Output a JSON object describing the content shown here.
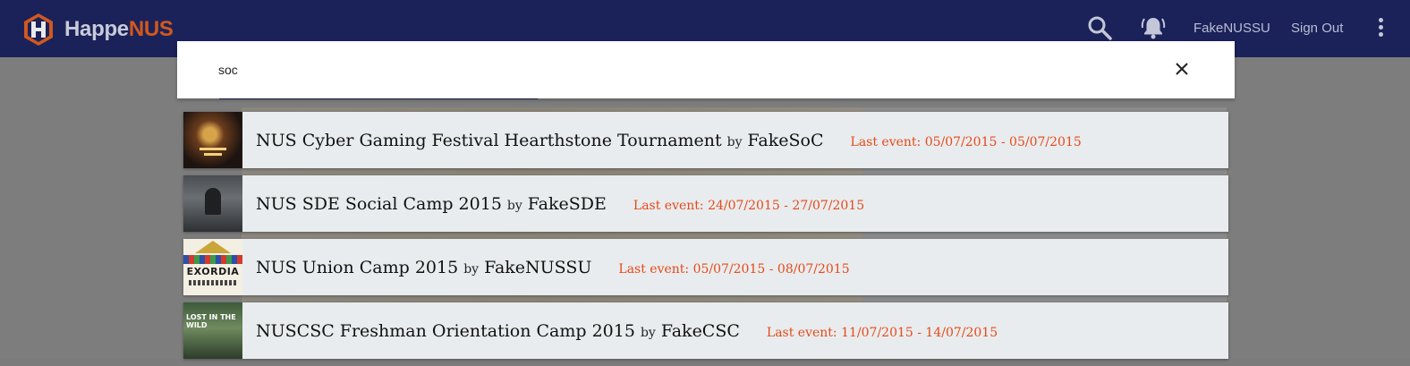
{
  "app": {
    "brand_part1": "Happe",
    "brand_part2": "NUS",
    "brand_color": "#d1581e",
    "topbar_color": "#1b2259"
  },
  "topbar": {
    "search_icon": "search-icon",
    "notification_icon": "bell-ringing-icon",
    "user_label": "FakeNUSSU",
    "signout_label": "Sign Out",
    "menu_icon": "more-vert-icon"
  },
  "search": {
    "value": "soc",
    "close_icon": "close-icon"
  },
  "results": [
    {
      "title": "NUS Cyber Gaming Festival Hearthstone Tournament",
      "by": "by",
      "org": "FakeSoC",
      "last_event": "Last event: 05/07/2015 - 05/07/2015"
    },
    {
      "title": "NUS SDE Social Camp 2015",
      "by": "by",
      "org": "FakeSDE",
      "last_event": "Last event: 24/07/2015 - 27/07/2015"
    },
    {
      "title": "NUS Union Camp 2015",
      "by": "by",
      "org": "FakeNUSSU",
      "last_event": "Last event: 05/07/2015 - 08/07/2015"
    },
    {
      "title": "NUSCSC Freshman Orientation Camp 2015",
      "by": "by",
      "org": "FakeCSC",
      "last_event": "Last event: 11/07/2015 - 14/07/2015"
    }
  ],
  "thumbnails": {
    "exordia_text": "EXORDIA",
    "lost_text": "LOST IN THE WILD"
  },
  "colors": {
    "last_event": "#e64a19",
    "result_bg": "#e9ecee"
  }
}
